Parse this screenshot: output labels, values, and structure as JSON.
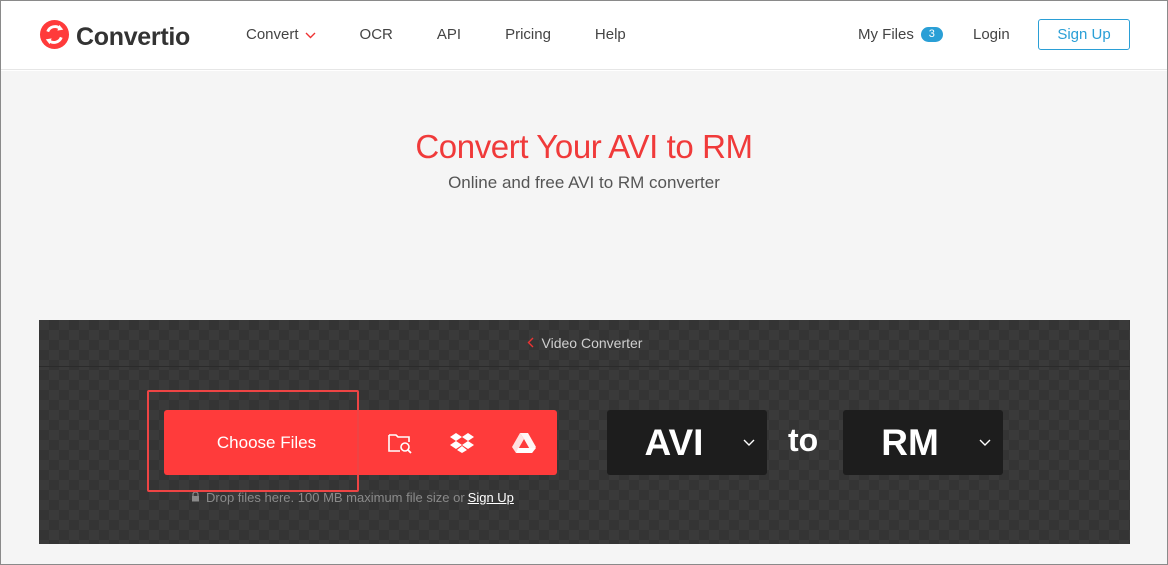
{
  "brand": {
    "name": "Convertio",
    "accent": "#f03a3a"
  },
  "nav": {
    "items": [
      {
        "label": "Convert",
        "has_dropdown": true
      },
      {
        "label": "OCR"
      },
      {
        "label": "API"
      },
      {
        "label": "Pricing"
      },
      {
        "label": "Help"
      }
    ],
    "my_files_label": "My Files",
    "my_files_count": "3",
    "login_label": "Login",
    "signup_label": "Sign Up"
  },
  "hero": {
    "title": "Convert Your AVI to RM",
    "subtitle": "Online and free AVI to RM converter"
  },
  "converter": {
    "breadcrumb_label": "Video Converter",
    "choose_files_label": "Choose Files",
    "upload_icons": [
      "folder-search-icon",
      "dropbox-icon",
      "google-drive-icon"
    ],
    "drop_note": "Drop files here. 100 MB maximum file size or",
    "drop_note_link": "Sign Up",
    "from_format": "AVI",
    "to_label": "to",
    "to_format": "RM"
  }
}
